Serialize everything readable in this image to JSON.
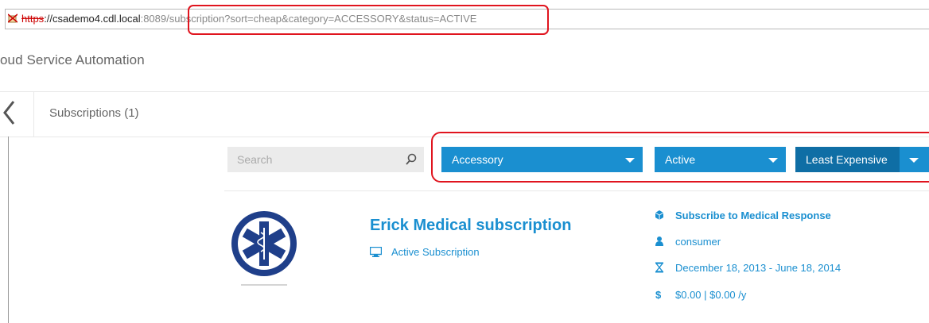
{
  "browser": {
    "url_scheme": "https",
    "url_host": "://csademo4.cdl.local",
    "url_port": ":8089",
    "url_path": "/subscription?sort=cheap&category=ACCESSORY&status=ACTIVE"
  },
  "app": {
    "title": "oud Service Automation"
  },
  "nav": {
    "section_label": "Subscriptions (1)"
  },
  "filters": {
    "search_placeholder": "Search",
    "category": "Accessory",
    "status": "Active",
    "sort": "Least Expensive"
  },
  "subscription": {
    "title": "Erick Medical subscription",
    "status": "Active Subscription",
    "offering": "Subscribe to Medical Response",
    "owner": "consumer",
    "dates": "December 18, 2013 - June 18, 2014",
    "price": "$0.00 | $0.00 /y"
  },
  "colors": {
    "accent": "#1a8fd0",
    "accent_dark": "#0f6ea5",
    "highlight": "#e0141e"
  }
}
